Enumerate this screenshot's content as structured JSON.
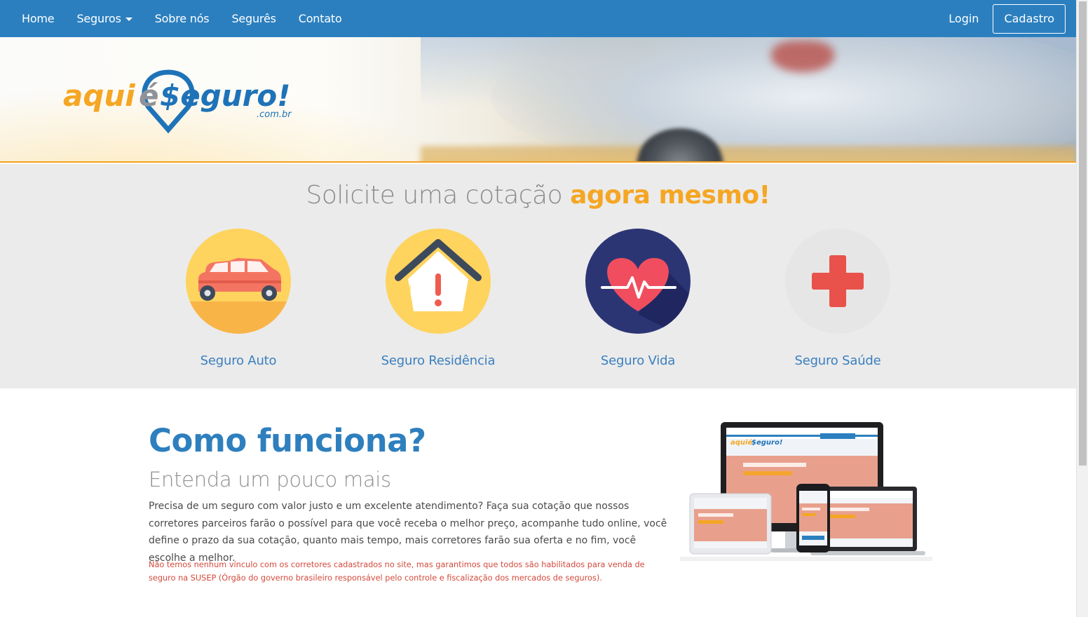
{
  "nav": {
    "items": [
      "Home",
      "Seguros",
      "Sobre nós",
      "Segurês",
      "Contato"
    ],
    "login": "Login",
    "signup": "Cadastro"
  },
  "brand": {
    "aqui": "aqui",
    "e": "é",
    "seguro": "$eguro!",
    "domain": ".com.br"
  },
  "quote": {
    "title_plain": "Solicite uma cotação ",
    "title_highlight": "agora mesmo!",
    "options": [
      {
        "label": "Seguro Auto",
        "icon": "car-icon"
      },
      {
        "label": "Seguro Residência",
        "icon": "house-alert-icon"
      },
      {
        "label": "Seguro Vida",
        "icon": "heart-pulse-icon"
      },
      {
        "label": "Seguro Saúde",
        "icon": "medical-cross-icon"
      }
    ]
  },
  "how": {
    "title": "Como funciona?",
    "subtitle": "Entenda um pouco mais",
    "text": "Precisa de um seguro com valor justo e um excelente atendimento? Faça sua cotação que nossos corretores parceiros farão o possível para que você receba o melhor preço, acompanhe tudo online, você define o prazo da sua cotação, quanto mais tempo, mais corretores farão sua oferta e no fim, você escolhe a melhor.",
    "note": "Não temos nenhum vínculo com os corretores cadastrados no site, mas garantimos que todos são habilitados para venda de seguro na SUSEP (Órgão do governo brasileiro responsável pelo controle e fiscalização dos mercados de seguros)."
  },
  "colors": {
    "primary": "#2b7fbf",
    "accent": "#f5a623",
    "note": "#d34a3c",
    "section_bg": "#ebebeb"
  }
}
